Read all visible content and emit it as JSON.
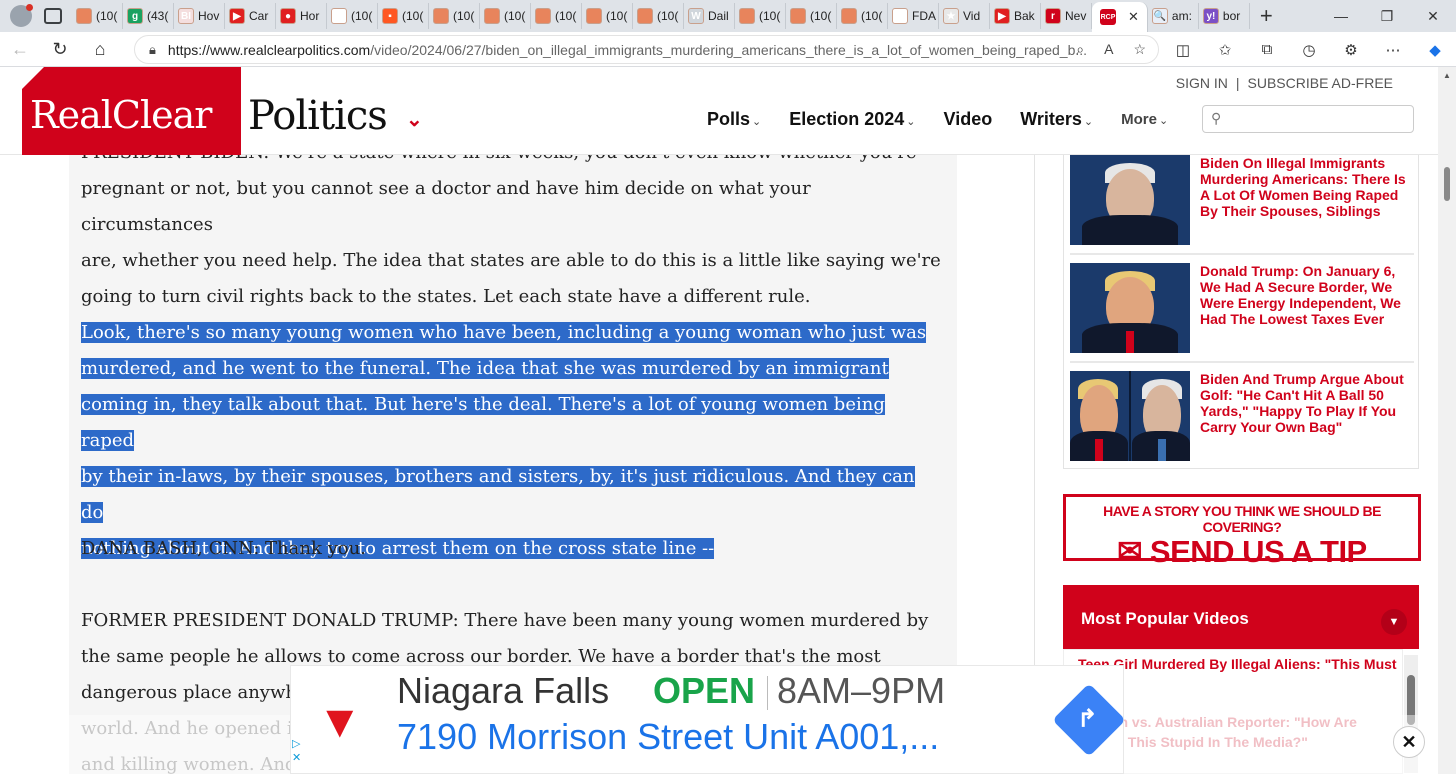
{
  "browser": {
    "tabs": [
      {
        "label": "(10(",
        "fav": "#e8845c",
        "glyph": ""
      },
      {
        "label": "(43(",
        "fav": "#1aa260",
        "glyph": "g"
      },
      {
        "label": "Hov",
        "fav": "#f4dede",
        "glyph": "BI"
      },
      {
        "label": "Car",
        "fav": "#e02020",
        "glyph": "▶"
      },
      {
        "label": "Hor",
        "fav": "#e02020",
        "glyph": "●"
      },
      {
        "label": "(10(",
        "fav": "#ffffff",
        "glyph": "▯"
      },
      {
        "label": "(10(",
        "fav": "#ff5722",
        "glyph": "▪"
      },
      {
        "label": "(10(",
        "fav": "#e8845c",
        "glyph": ""
      },
      {
        "label": "(10(",
        "fav": "#e8845c",
        "glyph": ""
      },
      {
        "label": "(10(",
        "fav": "#e8845c",
        "glyph": ""
      },
      {
        "label": "(10(",
        "fav": "#e8845c",
        "glyph": ""
      },
      {
        "label": "(10(",
        "fav": "#e8845c",
        "glyph": ""
      },
      {
        "label": "Dail",
        "fav": "#d0d6dc",
        "glyph": "W"
      },
      {
        "label": "(10(",
        "fav": "#e8845c",
        "glyph": ""
      },
      {
        "label": "(10(",
        "fav": "#e8845c",
        "glyph": ""
      },
      {
        "label": "(10(",
        "fav": "#e8845c",
        "glyph": ""
      },
      {
        "label": "FDA",
        "fav": "#ffffff",
        "glyph": "▯"
      },
      {
        "label": "Vid",
        "fav": "#e8e8e8",
        "glyph": "★"
      },
      {
        "label": "Bak",
        "fav": "#e02020",
        "glyph": "▶"
      },
      {
        "label": "Nev",
        "fav": "#d0021b",
        "glyph": "r"
      }
    ],
    "active_tab": {
      "fav": "#d0021b",
      "glyph": "RCP"
    },
    "trailing_tabs": [
      {
        "label": "am:",
        "fav": "#e8eef7",
        "glyph": "🔍"
      },
      {
        "label": "bor",
        "fav": "#7b50c6",
        "glyph": "y!"
      }
    ],
    "new_tab": "+",
    "url_host": "https://www.realclearpolitics.com",
    "url_path": "/video/2024/06/27/biden_on_illegal_immigrants_murdering_americans_there_is_a_lot_of_women_being_raped_b..."
  },
  "site": {
    "logo_left": "RealClear",
    "logo_right": "Politics",
    "sign_in": "SIGN IN",
    "separator": "|",
    "subscribe": "SUBSCRIBE AD-FREE",
    "nav": [
      "Polls",
      "Election 2024",
      "Video",
      "Writers",
      "More"
    ]
  },
  "article": {
    "top_clipped": "PRESIDENT BIDEN: We're a state where in six weeks, you don't even know whether you're",
    "para1": [
      "pregnant or not, but you cannot see a doctor and have him decide on what your circumstances",
      "are, whether you need help. The idea that states are able to do this is a little like saying we're",
      "going to turn civil rights back to the states. Let each state have a different rule."
    ],
    "highlighted": [
      "Look, there's so many young women who have been, including a young woman who just was",
      "murdered, and he went to the funeral. The idea that she was murdered by an immigrant",
      "coming in, they talk about that. But here's the deal. There's a lot of young women being raped",
      "by their in-laws, by their spouses, brothers and sisters, by, it's just ridiculous. And they can do",
      "nothing about it. And they try to arrest them on the cross state line --"
    ],
    "bash": "DANA BASH, CNN: Thank you.",
    "trump": [
      "FORMER PRESIDENT DONALD TRUMP: There have been many young women murdered by",
      "the same people he allows to come across our border. We have a border that's the most",
      "dangerous place anywhere in the",
      "world. And he opened it up, and these",
      "and killing women. And"
    ]
  },
  "related": [
    {
      "title": "Biden On Illegal Immigrants Murdering Americans: There Is A Lot Of Women Being Raped By Their Spouses, Siblings"
    },
    {
      "title": "Donald Trump: On January 6, We Had A Secure Border, We Were Energy Independent, We Had The Lowest Taxes Ever"
    },
    {
      "title": "Biden And Trump Argue About Golf: \"He Can't Hit A Ball 50 Yards,\" \"Happy To Play If You Carry Your Own Bag\""
    }
  ],
  "tip": {
    "line1": "HAVE A STORY YOU THINK WE SHOULD BE COVERING?",
    "line2": "SEND US A TIP"
  },
  "popular": {
    "heading": "Most Popular Videos",
    "items": [
      "Teen Girl Murdered By Illegal Aliens: \"This Must Stop\"",
      "Watson vs. Australian Reporter: \"How Are People This Stupid In The Media?\""
    ]
  },
  "ad": {
    "name": "Niagara Falls",
    "status": "OPEN",
    "hours": "8AM–9PM",
    "address": "7190 Morrison Street Unit A001,..."
  },
  "colors": {
    "brand_red": "#d0021b",
    "highlight": "#2d6ac9",
    "ad_open": "#19a44a",
    "ad_link": "#1a73e8"
  }
}
